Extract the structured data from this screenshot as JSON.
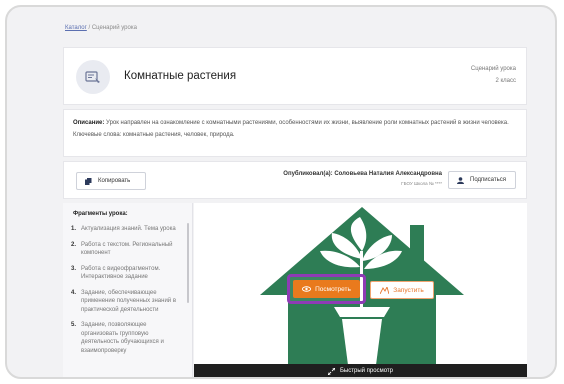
{
  "breadcrumb": {
    "link": "Каталог",
    "separator": " / ",
    "current": "Сценарий урока"
  },
  "header": {
    "title": "Комнатные растения",
    "type": "Сценарий урока",
    "grade": "2 класс"
  },
  "description": {
    "label": "Описание:",
    "text": " Урок направлен на ознакомление с комнатными растениями, особенностями их жизни, выявление роли комнатных растений в жизни человека.",
    "keywords": "Ключевые слова: комнатные растения, человек, природа."
  },
  "actions": {
    "copy_label": "Копировать",
    "subscribe_label": "Подписаться",
    "publisher_label": "Опубликовал(а): Соловьева Наталия Александровна",
    "school": "ГБОУ Школа № ****"
  },
  "fragments": {
    "title": "Фрагменты урока:",
    "items": [
      {
        "num": "1.",
        "label": "Актуализация знаний. Тема урока"
      },
      {
        "num": "2.",
        "label": "Работа с текстом. Региональный компонент"
      },
      {
        "num": "3.",
        "label": "Работа с видеофрагментом. Интерактивное задание"
      },
      {
        "num": "4.",
        "label": "Задание, обеспечивающее применение полученных знаний в практической деятельности"
      },
      {
        "num": "5.",
        "label": "Задание, позволяющее организовать групповую деятельность обучающихся и взаимопроверку"
      }
    ]
  },
  "preview": {
    "view_label": "Посмотреть",
    "run_label": "Запустить",
    "quick_view_label": "Быстрый просмотр"
  },
  "colors": {
    "accent_orange": "#e97a1d",
    "house_green": "#2e7d55",
    "highlight_purple": "#8e3bb5"
  }
}
